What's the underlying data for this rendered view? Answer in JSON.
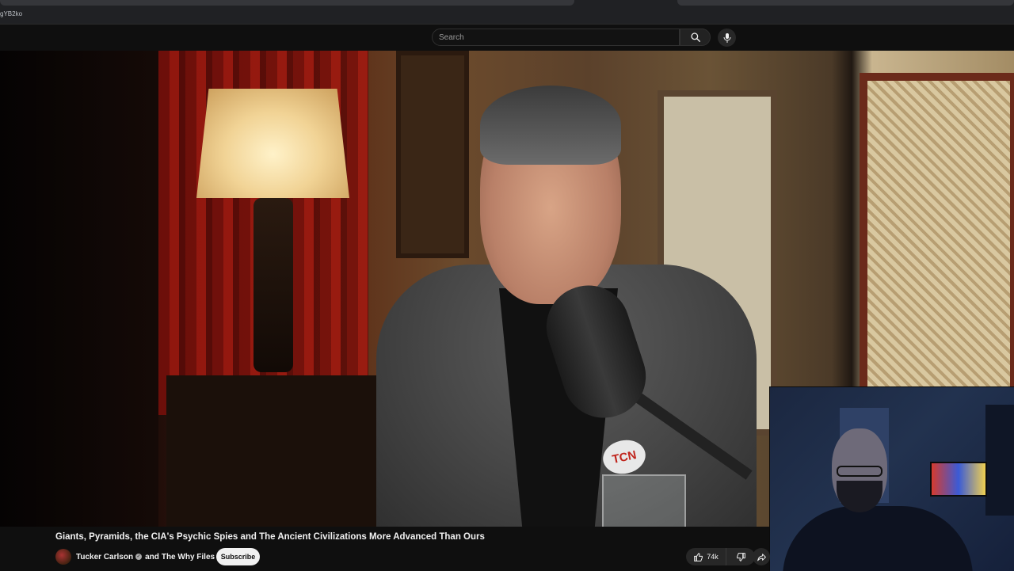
{
  "browser": {
    "url_fragment": "gYB2ko"
  },
  "header": {
    "search_placeholder": "Search",
    "search_icon": "search-icon",
    "mic_icon": "microphone-icon"
  },
  "video": {
    "mic_logo_text": "TCN"
  },
  "info": {
    "title": "Giants, Pyramids, the CIA's Psychic Spies and The Ancient Civilizations More Advanced Than Ours",
    "channel_one": "Tucker Carlson",
    "channel_joiner": "and",
    "channel_two": "The Why Files",
    "subscribe_label": "Subscribe",
    "like_count": "74k"
  },
  "colors": {
    "background": "#0f0f0f",
    "text": "#f1f1f1",
    "button_bg": "#272727"
  }
}
